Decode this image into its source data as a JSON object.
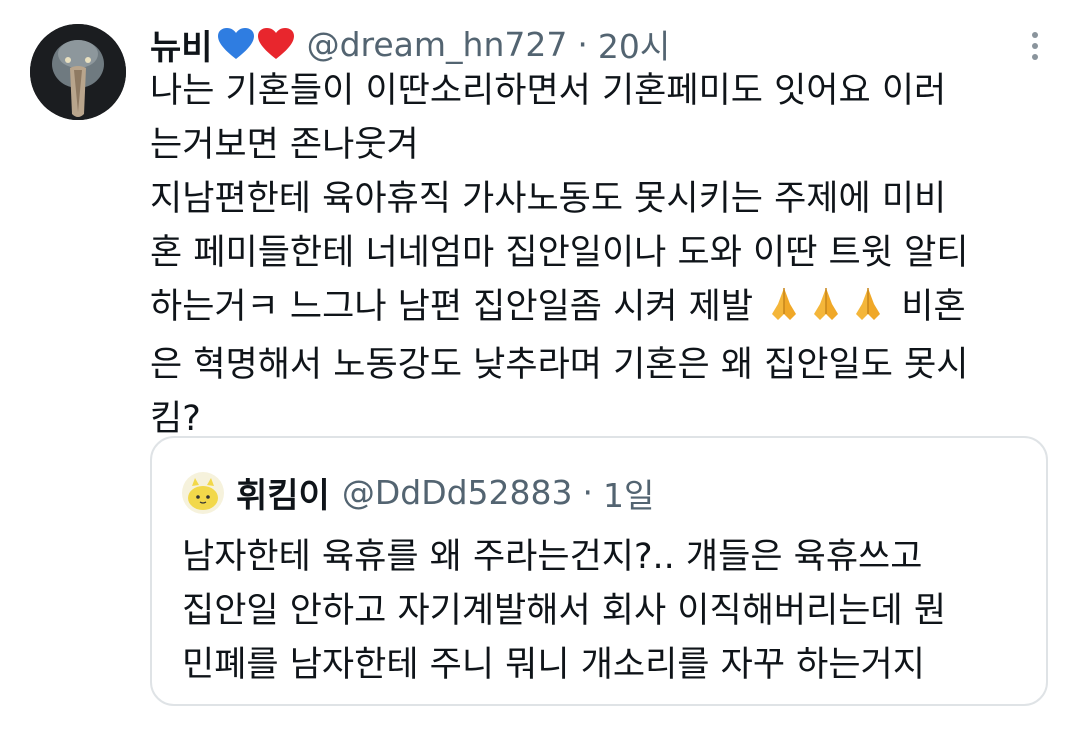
{
  "tweet": {
    "display_name": "뉴비",
    "hearts": [
      "blue-heart",
      "red-heart"
    ],
    "handle": "@dream_hn727",
    "separator": "·",
    "time": "20시",
    "body_lines": [
      "나는 기혼들이 이딴소리하면서 기혼페미도 잇어요 이러",
      "는거보면 존나웃겨",
      "지남편한테 육아휴직 가사노동도 못시키는 주제에 미비",
      "혼 페미들한테 너네엄마 집안일이나 도와 이딴 트윗 알티",
      "하는거ㅋ 느그나 남편 집안일좀 시켜 제발",
      " 비혼",
      "은 혁명해서 노동강도 낮추라며 기혼은 왜 집안일도 못시",
      "킴?"
    ],
    "emoji": "folded-hands"
  },
  "quoted": {
    "display_name": "휘킴이",
    "handle": "@DdDd52883",
    "separator": "·",
    "time": "1일",
    "body_lines": [
      "남자한테 육휴를 왜 주라는건지?.. 걔들은 육휴쓰고",
      "집안일 안하고 자기계발해서 회사 이직해버리는데 뭔",
      "민폐를 남자한테 주니 뭐니 개소리를 자꾸 하는거지"
    ]
  },
  "colors": {
    "text": "#0f1419",
    "muted": "#536471",
    "border": "#dfe3e6",
    "blue_heart": "#2f7de1",
    "red_heart": "#e8262d"
  }
}
